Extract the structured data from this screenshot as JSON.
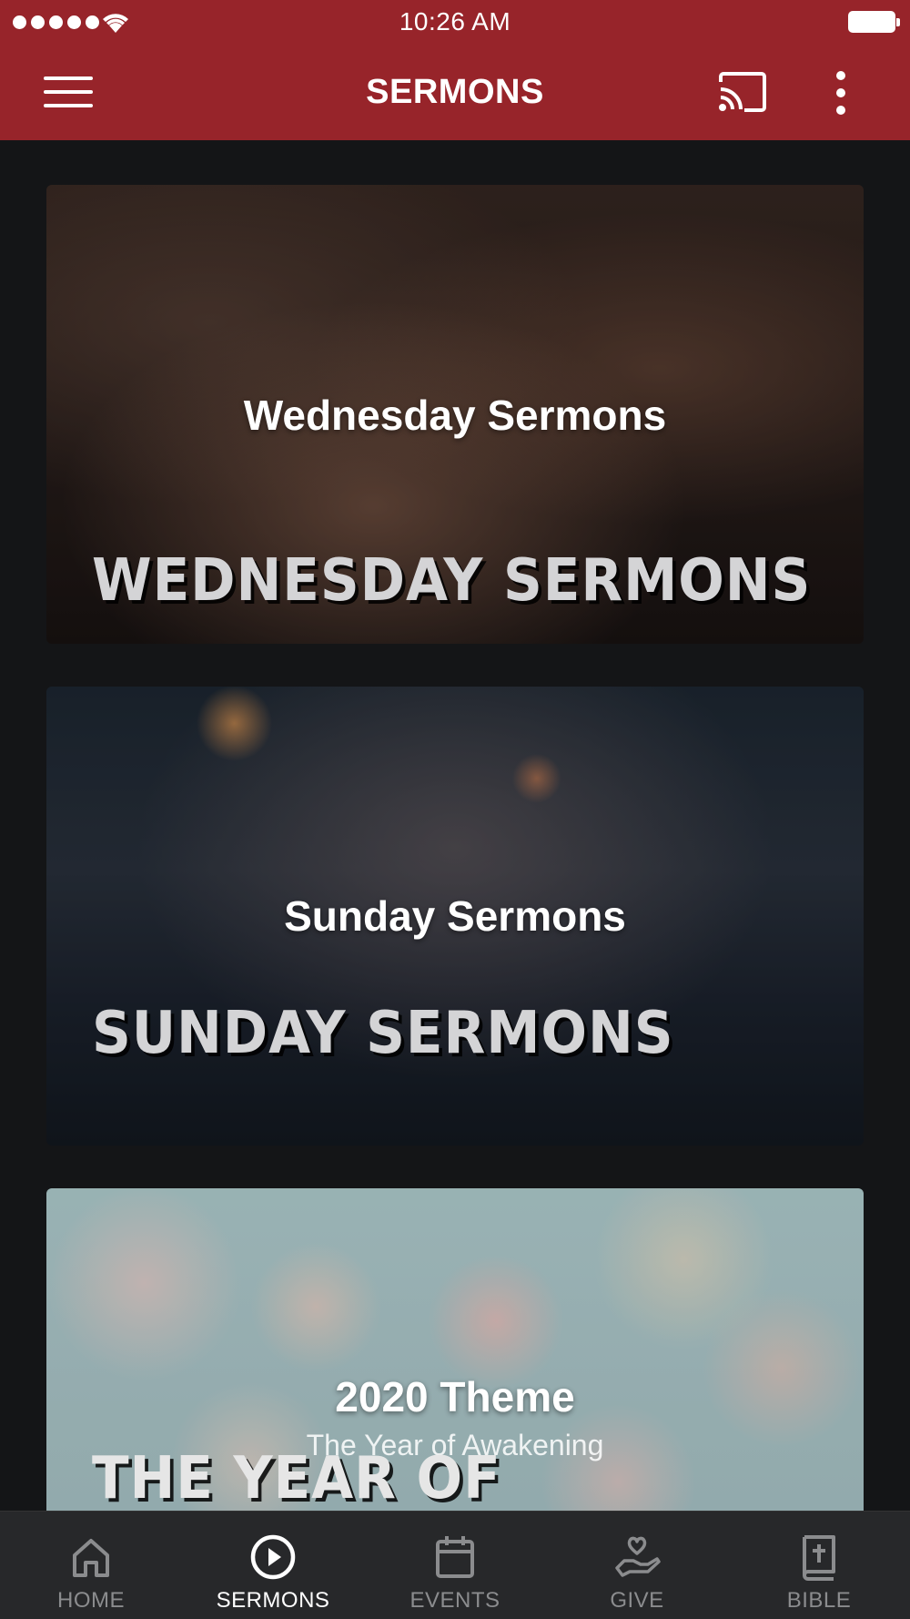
{
  "status_bar": {
    "time": "10:26 AM"
  },
  "header": {
    "title": "SERMONS"
  },
  "cards": [
    {
      "title": "Wednesday Sermons",
      "overlay_text": "WEDNESDAY SERMONS"
    },
    {
      "title": "Sunday Sermons",
      "overlay_text": "SUNDAY SERMONS"
    },
    {
      "title": "2020 Theme",
      "subtitle": "The Year of Awakening",
      "overlay_text": "THE YEAR OF"
    }
  ],
  "tabs": [
    {
      "label": "HOME",
      "icon": "home-icon",
      "active": false
    },
    {
      "label": "SERMONS",
      "icon": "play-circle-icon",
      "active": true
    },
    {
      "label": "EVENTS",
      "icon": "calendar-icon",
      "active": false
    },
    {
      "label": "GIVE",
      "icon": "give-heart-hand-icon",
      "active": false
    },
    {
      "label": "BIBLE",
      "icon": "bible-icon",
      "active": false
    }
  ],
  "colors": {
    "header_bg": "#97242a",
    "page_bg": "#141517",
    "tabbar_bg": "#27282a",
    "tab_active": "#ffffff",
    "tab_inactive": "#8b8c8e"
  }
}
